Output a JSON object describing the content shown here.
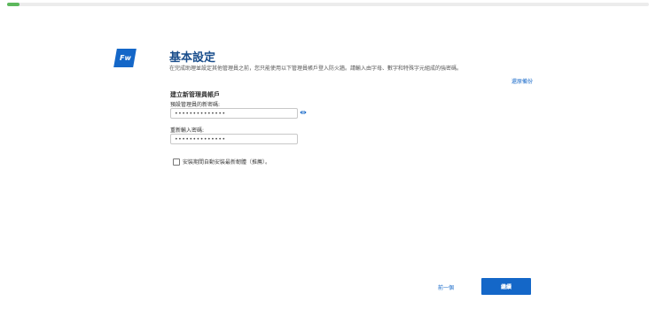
{
  "progress": {
    "fraction": 0.02,
    "color": "#5cb85c"
  },
  "logo": {
    "text": "Fw",
    "color": "#1467c8"
  },
  "header": {
    "title": "基本設定",
    "subtitle": "在完成助理並設定其他管理員之前，您只能使用以下管理員帳戶登入防火牆。請輸入由字母、數字和特殊字元組成的強密碼。"
  },
  "restore_link": "還原備份",
  "form": {
    "section_title": "建立新管理員帳戶",
    "password_label": "預設管理員的新密碼:",
    "password_value": "••••••••••••••",
    "confirm_label": "重新輸入密碼:",
    "confirm_value": "••••••••••••••",
    "show_password_icon": "eye-icon",
    "auto_update_label": "安裝期間自動安裝最新韌體（推薦）。",
    "auto_update_checked": false
  },
  "footer": {
    "back_label": "前一個",
    "continue_label": "繼續"
  },
  "colors": {
    "accent": "#1467c8",
    "title": "#1a4e8c"
  }
}
